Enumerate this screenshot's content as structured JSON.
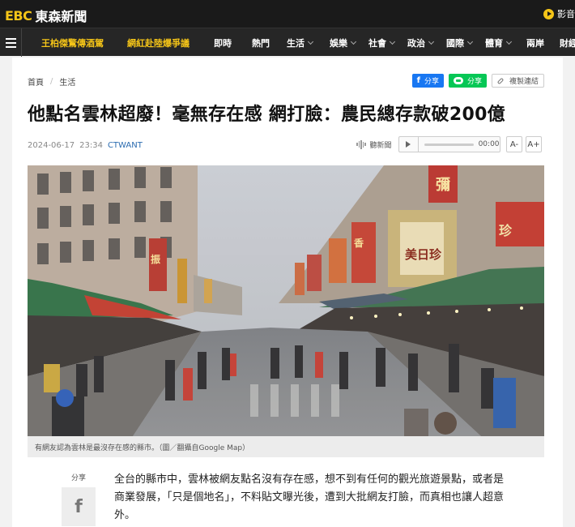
{
  "site": {
    "logo_mark": "EBC",
    "logo_name": "東森新聞",
    "video_label": "影音"
  },
  "nav": {
    "hot_items": [
      "王柏傑驚傳酒駕",
      "網紅赴陸爆爭議"
    ],
    "items": [
      {
        "label": "即時",
        "dropdown": false
      },
      {
        "label": "熱門",
        "dropdown": false
      },
      {
        "label": "生活",
        "dropdown": true
      },
      {
        "label": "娛樂",
        "dropdown": true
      },
      {
        "label": "社會",
        "dropdown": true
      },
      {
        "label": "政治",
        "dropdown": true
      },
      {
        "label": "國際",
        "dropdown": true
      },
      {
        "label": "體育",
        "dropdown": true
      },
      {
        "label": "兩岸",
        "dropdown": false
      },
      {
        "label": "財經",
        "dropdown": true
      }
    ]
  },
  "breadcrumb": {
    "home": "首頁",
    "category": "生活"
  },
  "share": {
    "facebook": "分享",
    "line": "分享",
    "copy": "複製連結"
  },
  "article": {
    "title": "他點名雲林超廢！毫無存在感 網打臉：農民總存款破200億",
    "date": "2024-06-17",
    "time": "23:34",
    "source": "CTWANT",
    "audio_label": "聽新聞",
    "audio_time": "00:00",
    "font_smaller": "A-",
    "font_larger": "A+",
    "image_caption": "有網友認為雲林是最沒存在感的縣市。（圖／翻攝自Google Map）",
    "side_share_label": "分享",
    "paragraph": "全台的縣市中，雲林被網友點名沒有存在感，想不到有任何的觀光旅遊景點，或者是商業發展，「只是個地名」，不料貼文曝光後，遭到大批網友打臉，而真相也讓人超意外。"
  },
  "colors": {
    "brand_yellow": "#f5c518",
    "topbar": "#1a1a1a",
    "navbar": "#262626",
    "facebook": "#1877f2",
    "line": "#06c755",
    "source_link": "#2b6cb0"
  },
  "image_signs": [
    "彌",
    "珍",
    "美日珍",
    "振",
    "香"
  ]
}
